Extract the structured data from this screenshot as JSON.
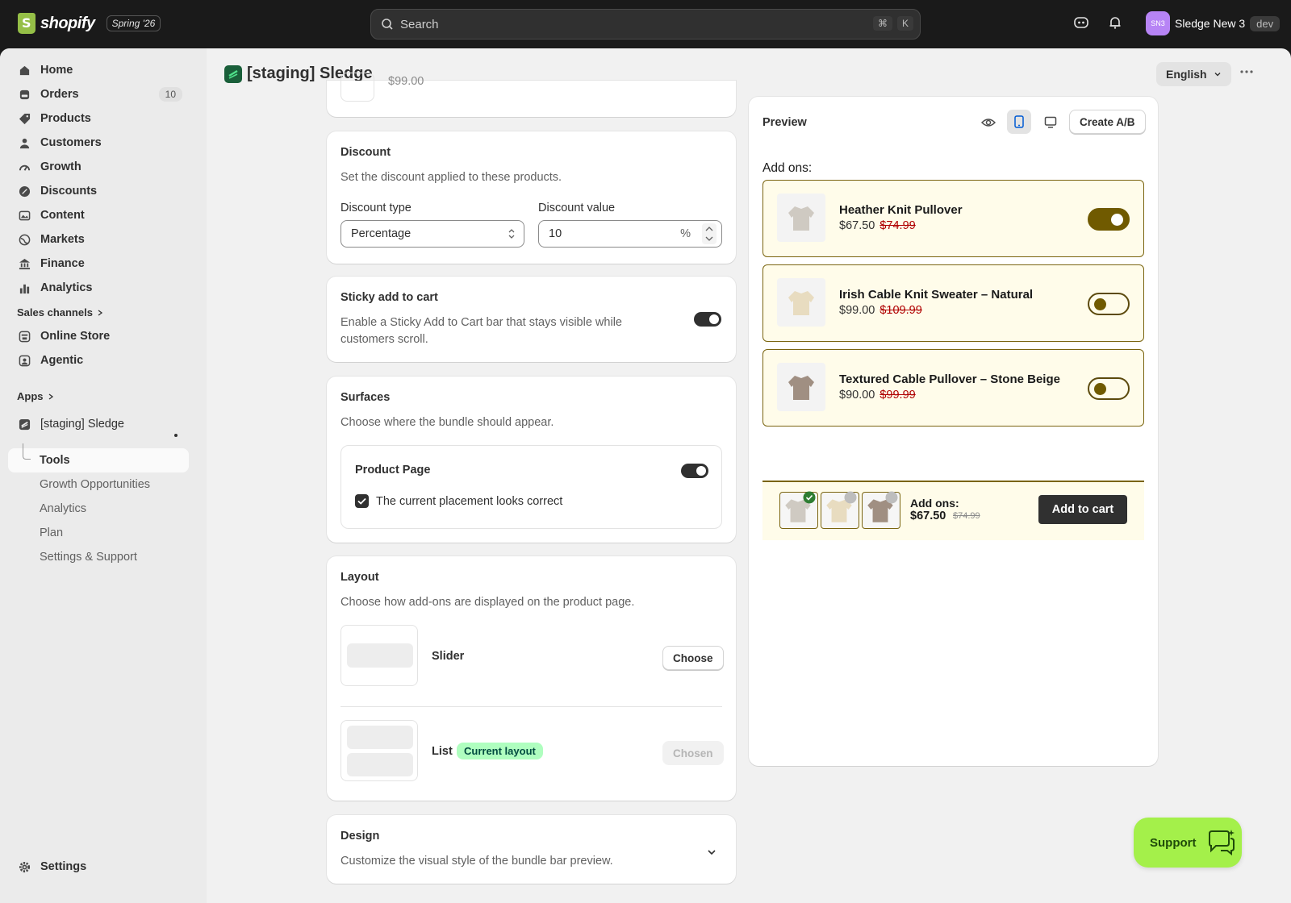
{
  "topbar": {
    "brand": "shopify",
    "edition": "Spring '26",
    "search_placeholder": "Search",
    "shortcut_cmd": "⌘",
    "shortcut_key": "K",
    "store_initials": "SN3",
    "store_name": "Sledge New 3",
    "env_badge": "dev"
  },
  "sidebar": {
    "items": [
      {
        "label": "Home"
      },
      {
        "label": "Orders",
        "count": "10"
      },
      {
        "label": "Products"
      },
      {
        "label": "Customers"
      },
      {
        "label": "Growth"
      },
      {
        "label": "Discounts"
      },
      {
        "label": "Content"
      },
      {
        "label": "Markets"
      },
      {
        "label": "Finance"
      },
      {
        "label": "Analytics"
      }
    ],
    "sales_channels_label": "Sales channels",
    "channels": [
      {
        "label": "Online Store"
      },
      {
        "label": "Agentic"
      }
    ],
    "apps_label": "Apps",
    "app": {
      "label": "[staging] Sledge",
      "sub": [
        "Tools",
        "Growth Opportunities",
        "Analytics",
        "Plan",
        "Settings & Support"
      ]
    },
    "settings_label": "Settings"
  },
  "page": {
    "title": "[staging] Sledge",
    "language": "English",
    "partial_price": "$99.00"
  },
  "discount": {
    "title": "Discount",
    "description": "Set the discount applied to these products.",
    "type_label": "Discount type",
    "type_value": "Percentage",
    "value_label": "Discount value",
    "value": "10",
    "suffix": "%"
  },
  "sticky": {
    "title": "Sticky add to cart",
    "description": "Enable a Sticky Add to Cart bar that stays visible while customers scroll.",
    "enabled": true
  },
  "surfaces": {
    "title": "Surfaces",
    "description": "Choose where the bundle should appear.",
    "product_page_label": "Product Page",
    "placement_label": "The current placement looks correct",
    "placement_checked": true
  },
  "layout": {
    "title": "Layout",
    "description": "Choose how add-ons are displayed on the product page.",
    "options": [
      {
        "label": "Slider",
        "button": "Choose"
      },
      {
        "label": "List",
        "badge": "Current layout",
        "button": "Chosen"
      }
    ]
  },
  "design": {
    "title": "Design",
    "description": "Customize the visual style of the bundle bar preview."
  },
  "preview": {
    "title": "Preview",
    "create_ab": "Create A/B",
    "addons_heading": "Add ons:",
    "addons": [
      {
        "name": "Heather Knit Pullover",
        "price": "$67.50",
        "compare": "$74.99",
        "selected": true
      },
      {
        "name": "Irish Cable Knit Sweater – Natural",
        "price": "$99.00",
        "compare": "$109.99",
        "selected": false
      },
      {
        "name": "Textured Cable Pullover – Stone Beige",
        "price": "$90.00",
        "compare": "$99.99",
        "selected": false
      }
    ],
    "bar": {
      "label": "Add ons:",
      "total": "$67.50",
      "compare": "$74.99",
      "button": "Add to cart"
    }
  },
  "support": {
    "label": "Support"
  },
  "colors": {
    "accent_gold": "#705a00",
    "support_green": "#a4f04a",
    "addon_bg": "#fffcea"
  }
}
